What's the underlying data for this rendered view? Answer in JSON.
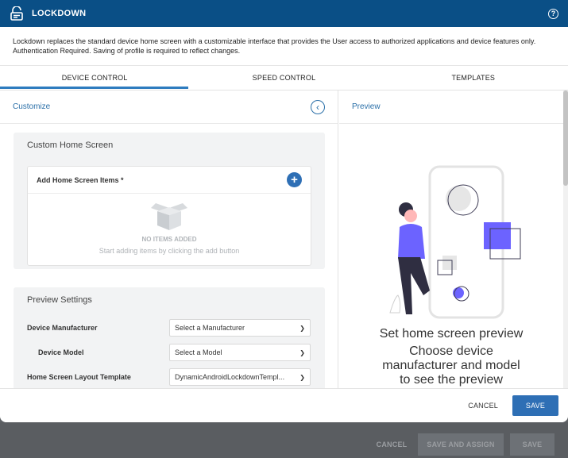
{
  "window": {
    "title": "LOCKDOWN",
    "help_icon": "question-circle-icon"
  },
  "description": "Lockdown replaces the standard device home screen with a customizable interface that provides the User access to authorized applications and device features only. Authentication Required. Saving of profile is required to reflect changes.",
  "tabs": [
    {
      "label": "DEVICE CONTROL",
      "active": true
    },
    {
      "label": "SPEED CONTROL",
      "active": false
    },
    {
      "label": "TEMPLATES",
      "active": false
    }
  ],
  "customize": {
    "title": "Customize",
    "custom_home_screen": {
      "title": "Custom Home Screen",
      "items_label": "Add Home Screen Items *",
      "empty_title": "NO ITEMS ADDED",
      "empty_hint": "Start adding items by clicking the add button"
    },
    "preview_settings": {
      "title": "Preview Settings",
      "fields": [
        {
          "label": "Device Manufacturer",
          "value": "Select a Manufacturer"
        },
        {
          "label": "Device Model",
          "value": "Select a Model"
        },
        {
          "label": "Home Screen Layout Template",
          "value": "DynamicAndroidLockdownTempl..."
        }
      ]
    }
  },
  "preview": {
    "title": "Preview",
    "heading": "Set home screen preview",
    "text": "Choose device manufacturer and model to see the preview"
  },
  "footer": {
    "cancel": "CANCEL",
    "save": "SAVE"
  },
  "background_actions": {
    "cancel": "CANCEL",
    "save_and_assign": "SAVE AND ASSIGN",
    "save": "SAVE"
  },
  "colors": {
    "header": "#0a4f86",
    "accent": "#2e6fb5",
    "illustration": "#6c63ff"
  }
}
